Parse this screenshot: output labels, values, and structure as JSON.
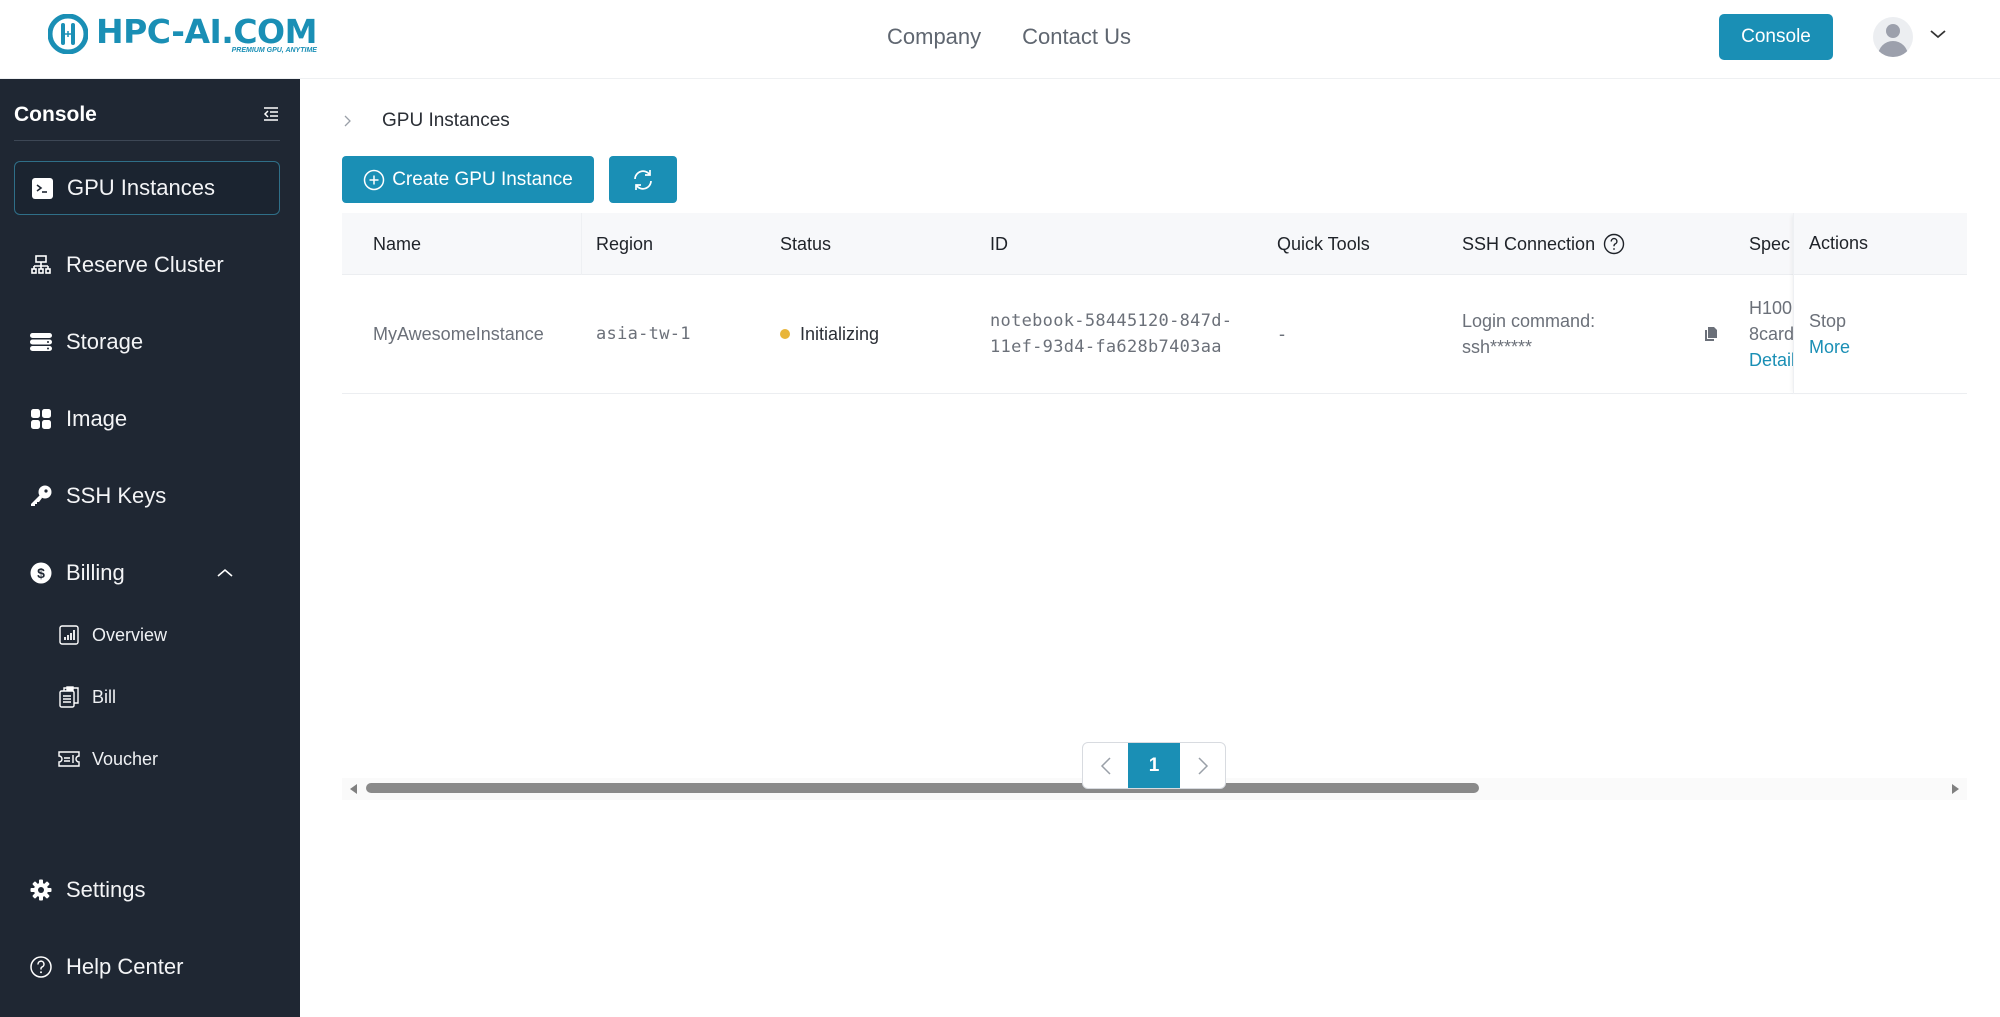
{
  "brand": {
    "name": "HPC-AI.COM",
    "tagline": "PREMIUM GPU, ANYTIME",
    "accent": "#1a8fb5"
  },
  "topnav": {
    "links": [
      {
        "label": "Company"
      },
      {
        "label": "Contact Us"
      }
    ],
    "console_button": "Console",
    "avatar_icon": "user-avatar-icon",
    "menu_icon": "chevron-down-icon"
  },
  "sidebar": {
    "title": "Console",
    "collapse_icon": "menu-fold-icon",
    "items": [
      {
        "label": "GPU Instances",
        "icon": "terminal-icon",
        "active": true
      },
      {
        "label": "Reserve Cluster",
        "icon": "cluster-icon"
      },
      {
        "label": "Storage",
        "icon": "storage-icon"
      },
      {
        "label": "Image",
        "icon": "grid-icon"
      },
      {
        "label": "SSH Keys",
        "icon": "key-icon"
      },
      {
        "label": "Billing",
        "icon": "dollar-icon",
        "expanded": true,
        "children": [
          {
            "label": "Overview",
            "icon": "chart-icon"
          },
          {
            "label": "Bill",
            "icon": "clipboard-icon"
          },
          {
            "label": "Voucher",
            "icon": "ticket-icon"
          }
        ]
      },
      {
        "label": "Settings",
        "icon": "gear-icon"
      },
      {
        "label": "Help Center",
        "icon": "help-circle-icon"
      }
    ]
  },
  "breadcrumb": {
    "current": "GPU Instances"
  },
  "toolbar": {
    "create_label": "Create GPU Instance",
    "refresh_icon": "refresh-icon"
  },
  "table": {
    "columns": [
      "Name",
      "Region",
      "Status",
      "ID",
      "Quick Tools",
      "SSH Connection",
      "Spec",
      "Actions"
    ],
    "rows": [
      {
        "name": "MyAwesomeInstance",
        "region": "asia-tw-1",
        "status": "Initializing",
        "status_color": "#e8b53a",
        "id_line1": "notebook-58445120-847d-",
        "id_line2": "11ef-93d4-fa628b7403aa",
        "quick_tools": "-",
        "ssh_label": "Login command:",
        "ssh_value": "ssh******",
        "spec_line1": "H100",
        "spec_line2": "8card",
        "spec_link": "Details",
        "action_stop": "Stop",
        "action_more": "More"
      }
    ]
  },
  "pagination": {
    "current_page": "1"
  }
}
